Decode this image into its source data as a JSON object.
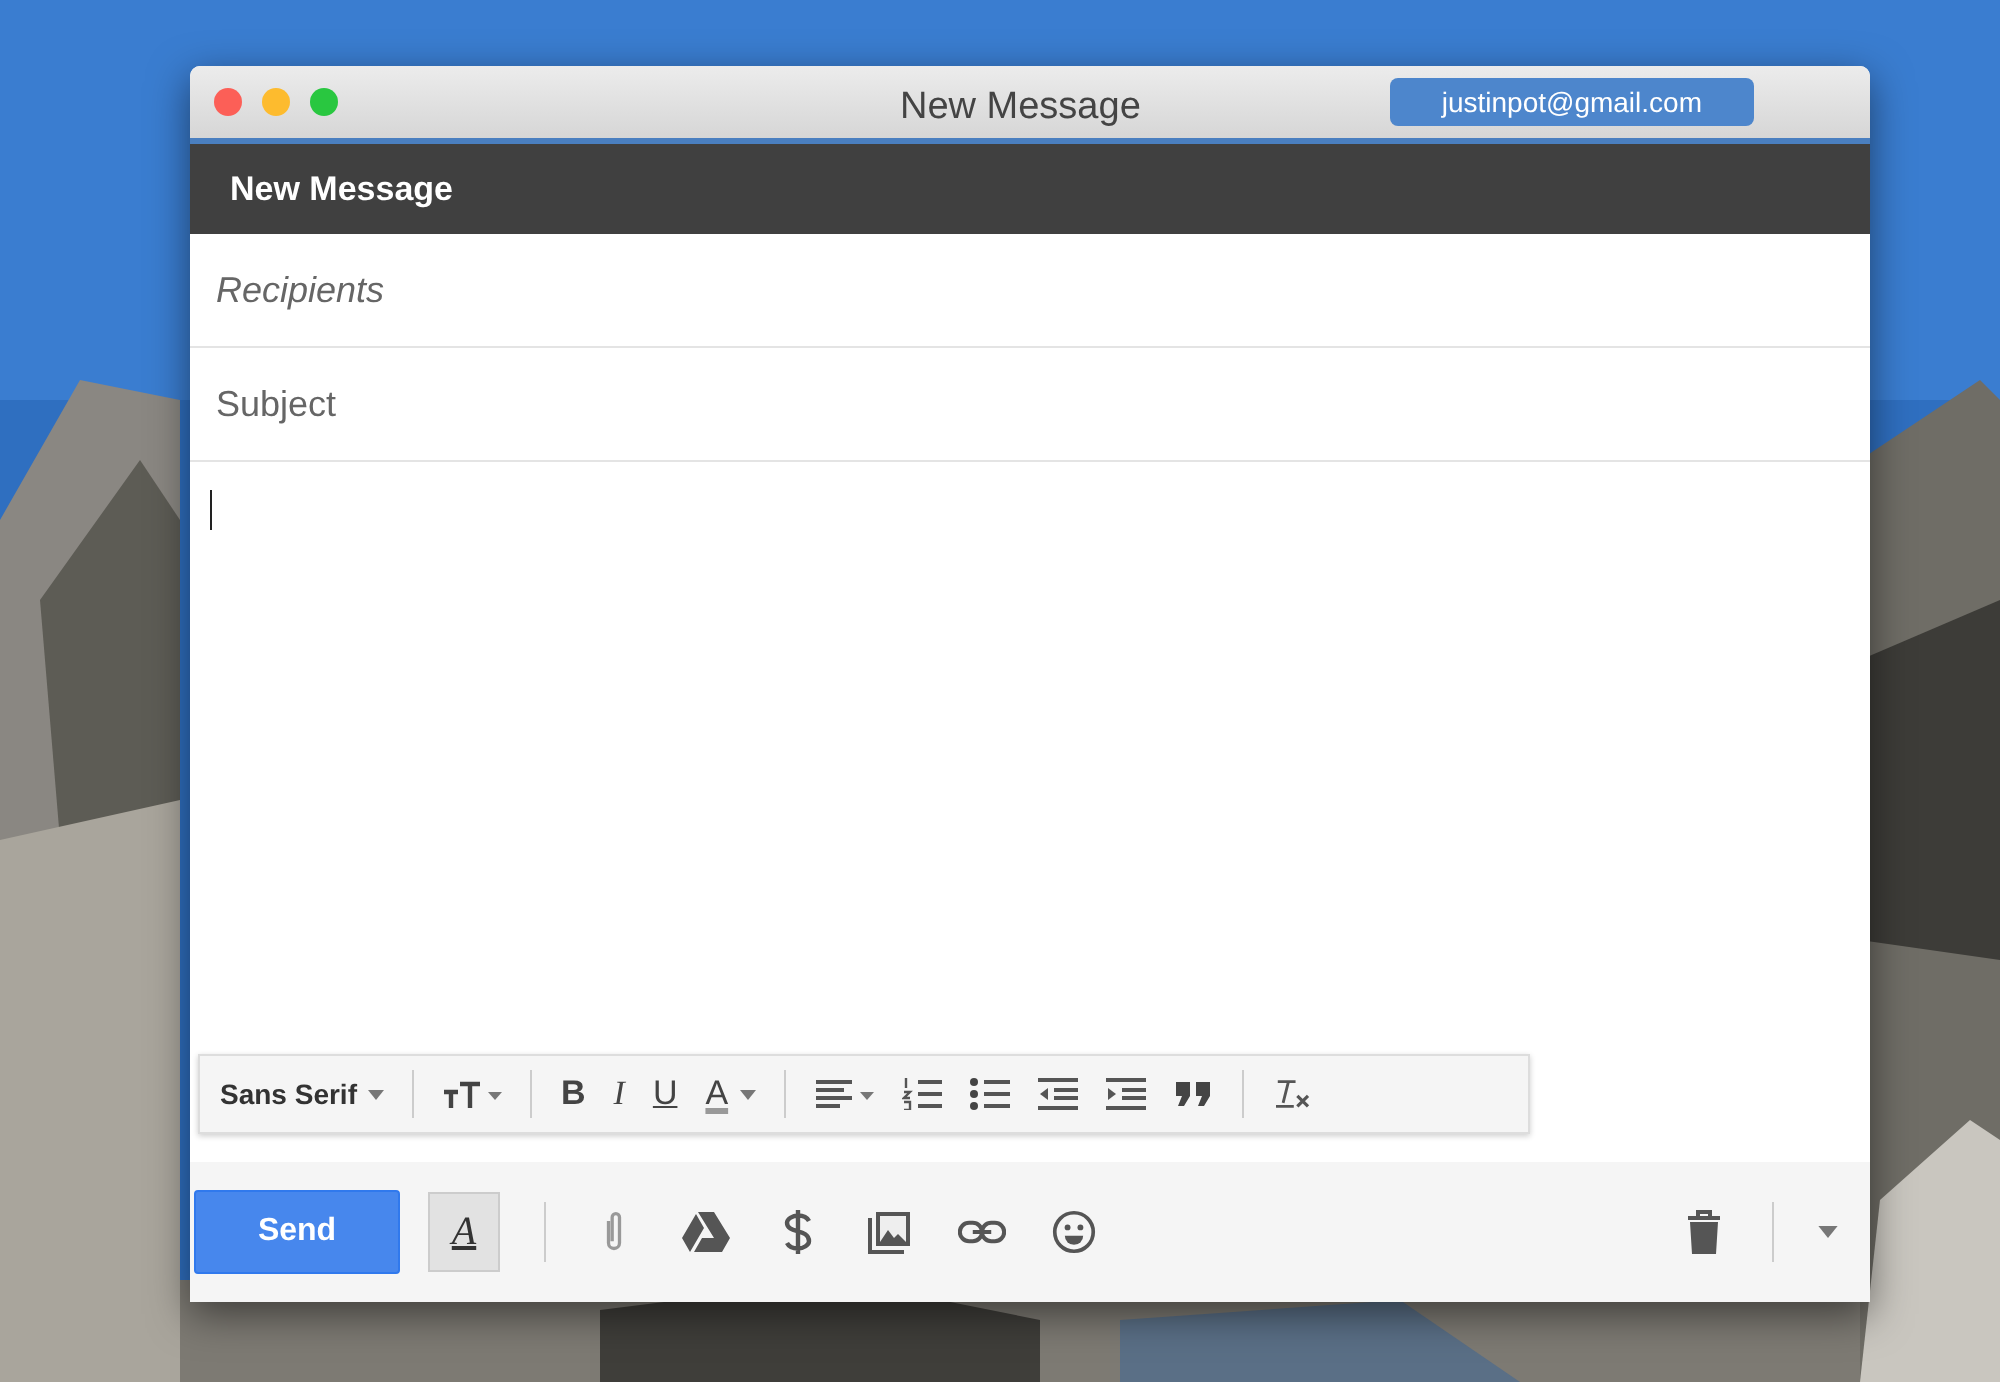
{
  "window": {
    "title": "New Message",
    "account": "justinpot@gmail.com"
  },
  "compose": {
    "header": "New Message",
    "recipients_placeholder": "Recipients",
    "subject_placeholder": "Subject"
  },
  "format_bar": {
    "font": "Sans Serif",
    "bold": "B",
    "italic": "I",
    "underline": "U",
    "text_color": "A"
  },
  "bottom_bar": {
    "send": "Send",
    "formatting_glyph": "A",
    "formatting_active": true
  }
}
